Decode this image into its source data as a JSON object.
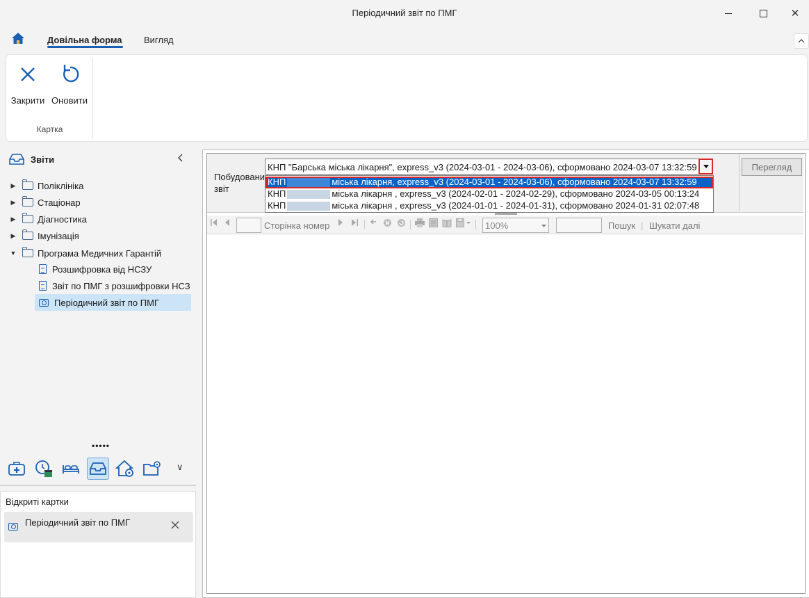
{
  "window": {
    "title": "Періодичний звіт по ПМГ",
    "minimize": "—",
    "maximize": "☐",
    "close": "✕"
  },
  "ribbon_tabs": {
    "home_icon": "home-icon",
    "active": "Довільна форма",
    "view": "Вигляд"
  },
  "ribbon": {
    "close_label": "Закрити",
    "refresh_label": "Оновити",
    "group_label": "Картка"
  },
  "sidebar": {
    "title": "Звіти",
    "tree": [
      {
        "label": "Поліклініка",
        "expanded": false
      },
      {
        "label": "Стаціонар",
        "expanded": false
      },
      {
        "label": "Діагностика",
        "expanded": false
      },
      {
        "label": "Імунізація",
        "expanded": false
      },
      {
        "label": "Програма Медичних Гарантій",
        "expanded": true
      },
      {
        "label": "Розшифровка від НСЗУ"
      },
      {
        "label": "Звіт по ПМГ з розшифровки НСЗ"
      },
      {
        "label": "Періодичний звіт по ПМГ",
        "selected": true
      }
    ],
    "dots": "•••••",
    "more": "∨"
  },
  "open_cards": {
    "title": "Відкриті картки",
    "item": "Періодичний звіт по ПМГ"
  },
  "report": {
    "param_label": "Побудований звіт",
    "combo_value": "КНП \"Барська міська лікарня\", express_v3 (2024-03-01 - 2024-03-06), сформовано 2024-03-07 13:32:59",
    "options": [
      {
        "prefix": "КНП",
        "suffix": "міська лікарня",
        "rest": ", express_v3 (2024-03-01 - 2024-03-06), сформовано 2024-03-07 13:32:59"
      },
      {
        "prefix": "КНП",
        "suffix": "міська лікарня",
        "rest": " , express_v3 (2024-02-01 - 2024-02-29), сформовано 2024-03-05 00:13:24"
      },
      {
        "prefix": "КНП",
        "suffix": "міська лікарня",
        "rest": " , express_v3 (2024-01-01 - 2024-01-31), сформовано 2024-01-31 02:07:48"
      }
    ],
    "view_button": "Перегляд"
  },
  "viewer_toolbar": {
    "page_label": "Сторінка номер",
    "zoom": "100%",
    "search": "Пошук",
    "search_next": "Шукати далі",
    "sep": "|"
  }
}
